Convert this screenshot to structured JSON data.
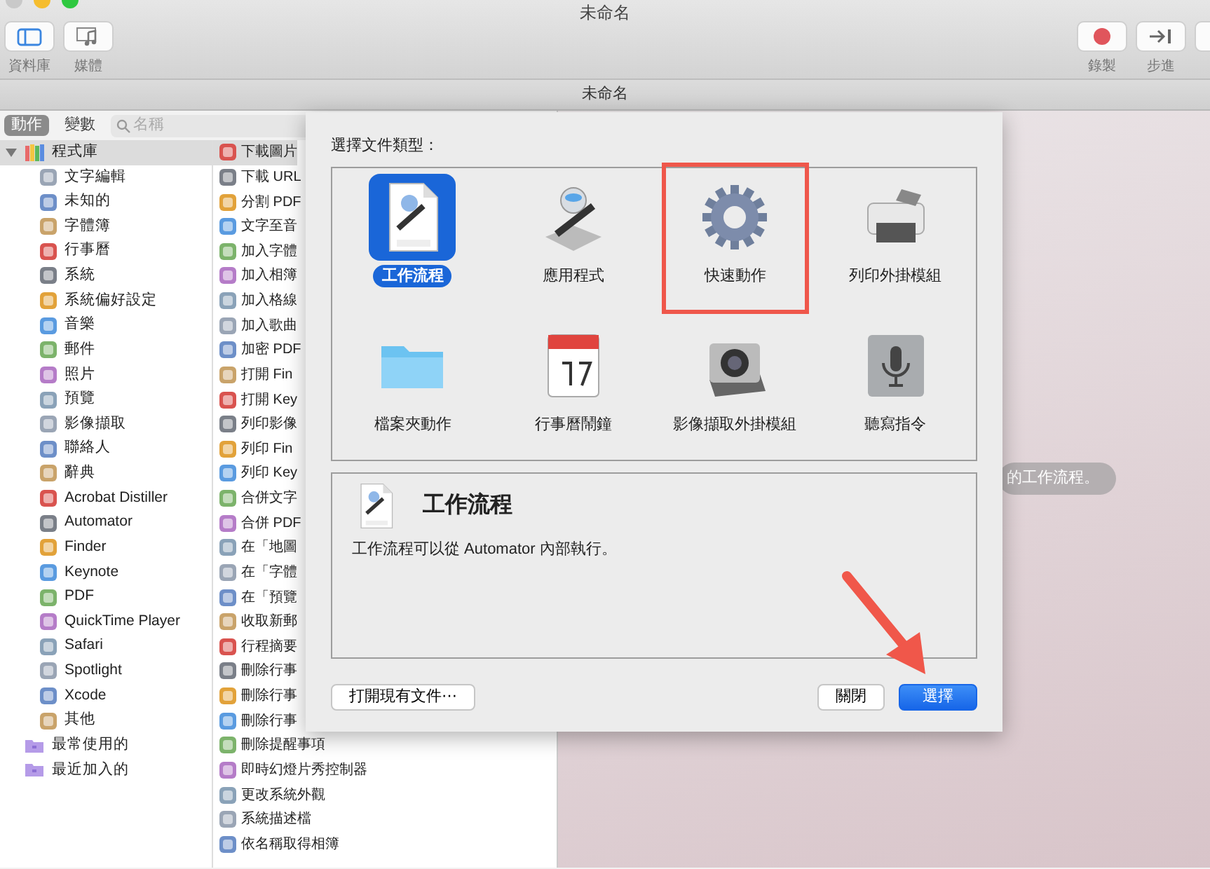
{
  "window": {
    "title": "未命名"
  },
  "toolbar_left": [
    {
      "label": "資料庫",
      "kind": "library"
    },
    {
      "label": "媒體",
      "kind": "media"
    }
  ],
  "toolbar_right": [
    {
      "label": "錄製",
      "kind": "record"
    },
    {
      "label": "步進",
      "kind": "step"
    },
    {
      "kind": "cut"
    }
  ],
  "document_tab": {
    "title": "未命名"
  },
  "panel_tabs": [
    {
      "label": "動作",
      "selected": true
    },
    {
      "label": "變數",
      "selected": false
    }
  ],
  "search": {
    "placeholder": "名稱"
  },
  "library": [
    {
      "label": "程式庫",
      "kind": "library",
      "expanded": true,
      "selected": true,
      "children": [
        {
          "label": "文字編輯"
        },
        {
          "label": "未知的"
        },
        {
          "label": "字體簿"
        },
        {
          "label": "行事曆"
        },
        {
          "label": "系統"
        },
        {
          "label": "系統偏好設定"
        },
        {
          "label": "音樂"
        },
        {
          "label": "郵件"
        },
        {
          "label": "照片"
        },
        {
          "label": "預覽"
        },
        {
          "label": "影像擷取"
        },
        {
          "label": "聯絡人"
        },
        {
          "label": "辭典"
        },
        {
          "label": "Acrobat Distiller"
        },
        {
          "label": "Automator"
        },
        {
          "label": "Finder"
        },
        {
          "label": "Keynote"
        },
        {
          "label": "PDF"
        },
        {
          "label": "QuickTime Player"
        },
        {
          "label": "Safari"
        },
        {
          "label": "Spotlight"
        },
        {
          "label": "Xcode"
        },
        {
          "label": "其他"
        }
      ]
    },
    {
      "label": "最常使用的",
      "kind": "folder",
      "selected": false
    },
    {
      "label": "最近加入的",
      "kind": "folder",
      "selected": false
    }
  ],
  "actions": [
    {
      "label": "下載圖片",
      "selected": true
    },
    {
      "label": "下載 URL",
      "selected": false
    },
    {
      "label": "分割 PDF",
      "selected": false
    },
    {
      "label": "文字至音",
      "selected": false
    },
    {
      "label": "加入字體",
      "selected": false
    },
    {
      "label": "加入相簿",
      "selected": false
    },
    {
      "label": "加入格線",
      "selected": false
    },
    {
      "label": "加入歌曲",
      "selected": false
    },
    {
      "label": "加密 PDF",
      "selected": false
    },
    {
      "label": "打開 Fin",
      "selected": false
    },
    {
      "label": "打開 Key",
      "selected": false
    },
    {
      "label": "列印影像",
      "selected": false
    },
    {
      "label": "列印 Fin",
      "selected": false
    },
    {
      "label": "列印 Key",
      "selected": false
    },
    {
      "label": "合併文字",
      "selected": false
    },
    {
      "label": "合併 PDF",
      "selected": false
    },
    {
      "label": "在「地圖",
      "selected": false
    },
    {
      "label": "在「字體",
      "selected": false
    },
    {
      "label": "在「預覽",
      "selected": false
    },
    {
      "label": "收取新郵",
      "selected": false
    },
    {
      "label": "行程摘要",
      "selected": false
    },
    {
      "label": "刪除行事",
      "selected": false
    },
    {
      "label": "刪除行事",
      "selected": false
    },
    {
      "label": "刪除行事",
      "selected": false
    },
    {
      "label": "刪除提醒事項",
      "selected": false
    },
    {
      "label": "即時幻燈片秀控制器",
      "selected": false
    },
    {
      "label": "更改系統外觀",
      "selected": false
    },
    {
      "label": "系統描述檔",
      "selected": false
    },
    {
      "label": "依名稱取得相簿",
      "selected": false
    }
  ],
  "hint_pill": {
    "text": "的工作流程。"
  },
  "dialog": {
    "prompt": "選擇文件類型：",
    "types": [
      {
        "label": "工作流程",
        "kind": "workflow",
        "selected": true,
        "highlighted": false
      },
      {
        "label": "應用程式",
        "kind": "application",
        "selected": false,
        "highlighted": false
      },
      {
        "label": "快速動作",
        "kind": "quick-action",
        "selected": false,
        "highlighted": true
      },
      {
        "label": "列印外掛模組",
        "kind": "print-plugin",
        "selected": false,
        "highlighted": false
      },
      {
        "label": "檔案夾動作",
        "kind": "folder-action",
        "selected": false,
        "highlighted": false
      },
      {
        "label": "行事曆鬧鐘",
        "kind": "calendar-alarm",
        "selected": false,
        "highlighted": false
      },
      {
        "label": "影像擷取外掛模組",
        "kind": "image-capture",
        "selected": false,
        "highlighted": false
      },
      {
        "label": "聽寫指令",
        "kind": "dictation",
        "selected": false,
        "highlighted": false
      }
    ],
    "description": {
      "title": "工作流程",
      "kind": "workflow",
      "text": "工作流程可以從 Automator 內部執行。"
    },
    "buttons": [
      {
        "label": "打開現有文件⋯",
        "kind": "secondary",
        "pointed": false
      },
      {
        "label": "關閉",
        "kind": "secondary",
        "pointed": false
      },
      {
        "label": "選擇",
        "kind": "primary",
        "pointed": true
      }
    ]
  }
}
